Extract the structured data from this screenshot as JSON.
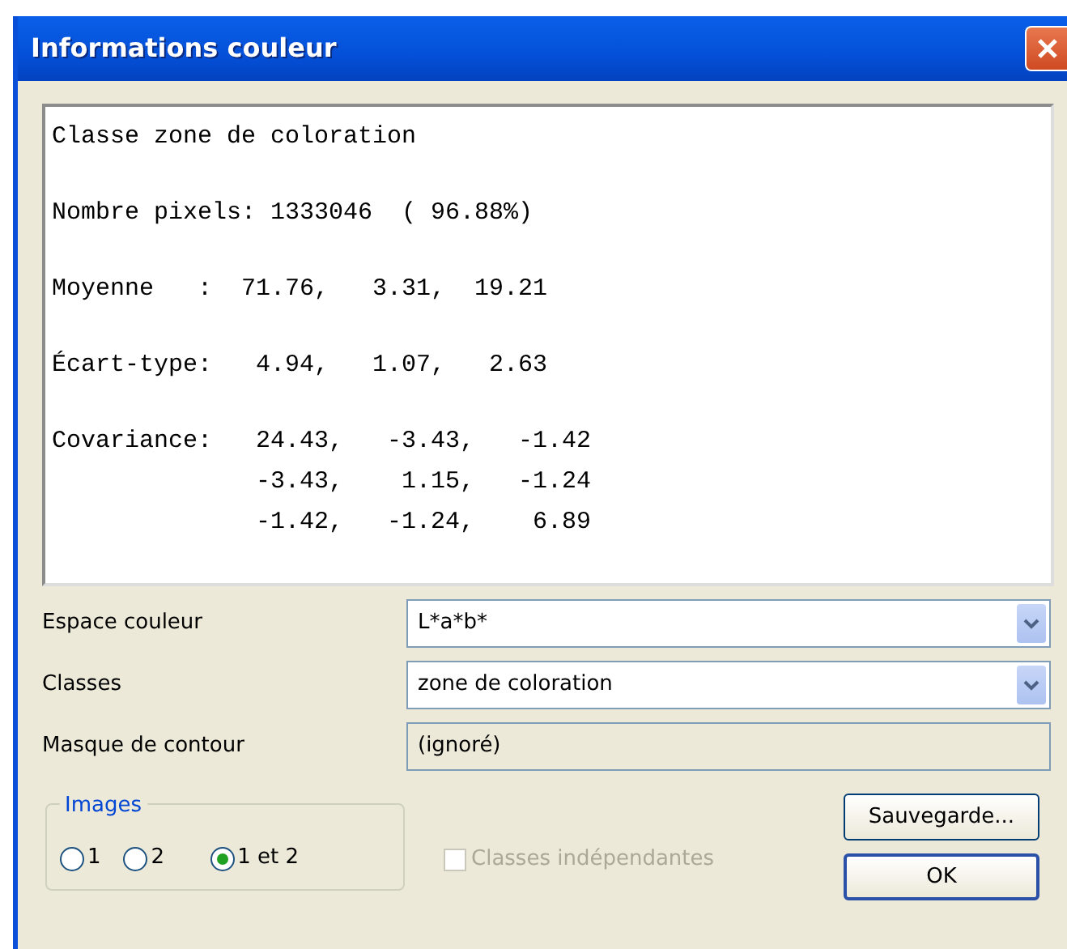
{
  "window": {
    "title": "Informations couleur"
  },
  "report": {
    "sections": [
      [
        "Classe zone de coloration"
      ],
      [
        "Nombre pixels: 1333046  ( 96.88%)"
      ],
      [
        "Moyenne   :  71.76,   3.31,  19.21"
      ],
      [
        "Écart-type:   4.94,   1.07,   2.63"
      ],
      [
        "Covariance:   24.43,   -3.43,   -1.42",
        "              -3.43,    1.15,   -1.24",
        "              -1.42,   -1.24,    6.89"
      ]
    ]
  },
  "fields": [
    {
      "label": "Espace couleur",
      "kind": "combo",
      "value": "L*a*b*"
    },
    {
      "label": "Classes",
      "kind": "combo",
      "value": "zone de coloration"
    },
    {
      "label": "Masque de contour",
      "kind": "readonly",
      "value": "(ignoré)"
    }
  ],
  "images": {
    "title": "Images",
    "options": [
      {
        "label": "1",
        "selected": false
      },
      {
        "label": "2",
        "selected": false
      },
      {
        "label": "1 et 2",
        "selected": true
      }
    ]
  },
  "checkbox": {
    "label": "Classes indépendantes",
    "checked": false,
    "disabled": true
  },
  "buttons": [
    {
      "label": "Sauvegarde...",
      "default": false
    },
    {
      "label": "OK",
      "default": true
    }
  ]
}
